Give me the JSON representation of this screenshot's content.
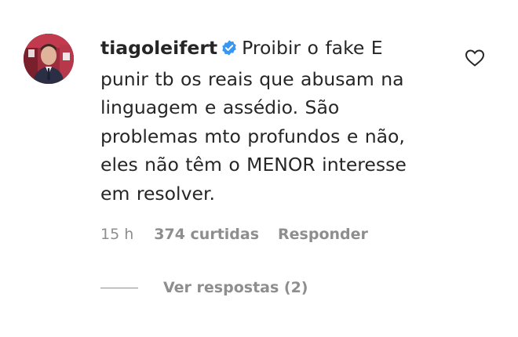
{
  "comment": {
    "username": "tiagoleifert",
    "verified_icon": "verified-badge-icon",
    "text": "Proibir o fake E punir tb os reais que abusam na linguagem e assédio. São problemas mto profundos e não, eles não têm o MENOR interesse em resolver.",
    "time": "15 h",
    "likes": "374 curtidas",
    "reply_label": "Responder",
    "view_replies_label": "Ver respostas (2)",
    "like_icon": "heart-outline-icon"
  },
  "colors": {
    "text": "#262626",
    "secondary": "#8e8e8e",
    "verified": "#3897f0"
  }
}
